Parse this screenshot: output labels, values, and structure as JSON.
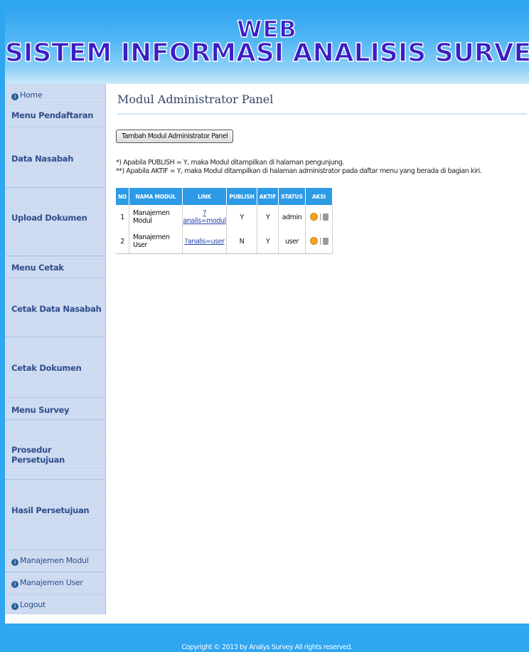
{
  "header": {
    "line1": "WEB",
    "line2": "SISTEM INFORMASI ANALISIS SURVEY"
  },
  "sidebar": {
    "items": [
      {
        "label": "Home",
        "icon": "info-icon"
      },
      {
        "label": "Menu Pendaftaran"
      },
      {
        "label": "Data Nasabah"
      },
      {
        "label": "Upload Dokumen"
      },
      {
        "label": "Menu Cetak"
      },
      {
        "label": "Cetak Data Nasabah"
      },
      {
        "label": "Cetak Dokumen"
      },
      {
        "label": "Menu Survey"
      },
      {
        "label": "Prosedur Persetujuan"
      },
      {
        "label": "Hasil Persetujuan"
      },
      {
        "label": "Manajemen Modul",
        "icon": "info-icon"
      },
      {
        "label": "Manajemen User",
        "icon": "info-icon"
      },
      {
        "label": "Logout",
        "icon": "info-icon"
      }
    ]
  },
  "main": {
    "title": "Modul Administrator Panel",
    "add_button": "Tambah Modul Administrator Panel",
    "note1": "*) Apabila PUBLISH = Y, maka Modul ditampilkan di halaman pengunjung.",
    "note2": "**) Apabila AKTIF = Y, maka Modul ditampilkan di halaman administrator pada daftar menu yang berada di bagian kiri.",
    "table": {
      "headers": [
        "NO",
        "NAMA MODUL",
        "LINK",
        "PUBLISH",
        "AKTIF",
        "STATUS",
        "AKSI"
      ],
      "rows": [
        {
          "no": "1",
          "nama": "Manajemen Modul",
          "link": "?analis=modul",
          "publish": "Y",
          "aktif": "Y",
          "status": "admin"
        },
        {
          "no": "2",
          "nama": "Manajemen User",
          "link": "?analis=user",
          "publish": "N",
          "aktif": "Y",
          "status": "user"
        }
      ],
      "action_icons": [
        "edit-icon",
        "delete-icon"
      ],
      "action_separator": "|"
    }
  },
  "footer": {
    "copyright": "Copyright © 2013 by Analys Survey All rights reserved."
  },
  "colors": {
    "frame_blue": "#2ea6f0",
    "header_text": "#3b1fc5",
    "table_header": "#2d9ae6",
    "sidebar_text": "#2f4e8c"
  }
}
